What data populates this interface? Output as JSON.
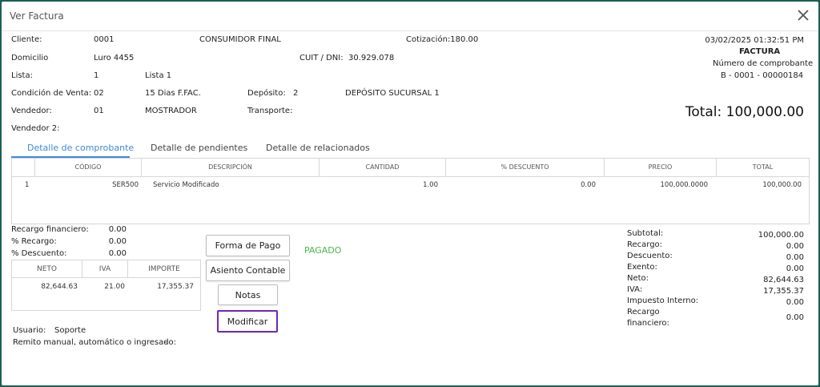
{
  "window": {
    "title": "Ver Factura",
    "close_icon": "close-icon"
  },
  "header": {
    "cliente_label": "Cliente:",
    "cliente_code": "0001",
    "cliente_name": "CONSUMIDOR FINAL",
    "cotizacion": "Cotización:180.00",
    "domicilio_label": "Domicilio",
    "domicilio_value": "Luro 4455",
    "cuit_label": "CUIT / DNI:",
    "cuit_value": "30.929.078",
    "lista_label": "Lista:",
    "lista_code": "1",
    "lista_name": "Lista 1",
    "condicion_label": "Condición de Venta:",
    "condicion_code": "02",
    "condicion_name": "15 Dias F.FAC.",
    "deposito_label": "Depósito:",
    "deposito_code": "2",
    "deposito_name": "DEPÓSITO SUCURSAL 1",
    "vendedor_label": "Vendedor:",
    "vendedor_code": "01",
    "vendedor_name": "MOSTRADOR",
    "transporte_label": "Transporte:",
    "vendedor2_label": "Vendedor 2:",
    "datetime": "03/02/2025 01:32:51 PM",
    "doc_type": "FACTURA",
    "comprobante_label": "Número de comprobante",
    "comprobante_number": "B - 0001 - 00000184",
    "total": "Total:  100,000.00"
  },
  "tabs": [
    "Detalle de comprobante",
    "Detalle de pendientes",
    "Detalle de relacionados"
  ],
  "detail": {
    "headers": [
      "CÓDIGO",
      "DESCRIPCIÓN",
      "CANTIDAD",
      "% DESCUENTO",
      "PRECIO",
      "TOTAL"
    ],
    "rows": [
      {
        "n": "1",
        "codigo": "SER500",
        "descripcion": "Servicio Modificado",
        "cantidad": "1.00",
        "descuento": "0.00",
        "precio": "100,000.0000",
        "total": "100,000.00"
      }
    ]
  },
  "left_summary": {
    "recargo_financiero_label": "Recargo financiero:",
    "recargo_financiero": "0.00",
    "recargo_pct_label": "% Recargo:",
    "recargo_pct": "0.00",
    "descuento_pct_label": "% Descuento:",
    "descuento_pct": "0.00"
  },
  "iva_table": {
    "headers": [
      "NETO",
      "IVA",
      "IMPORTE"
    ],
    "rows": [
      {
        "neto": "82,644.63",
        "iva": "21.00",
        "importe": "17,355.37"
      }
    ]
  },
  "usuario": {
    "label": "Usuario:",
    "value": "Soporte"
  },
  "remito": {
    "label": "Remito manual, automático o ingresado:",
    "value": "-"
  },
  "buttons": {
    "forma_pago": "Forma de Pago",
    "asiento": "Asiento Contable",
    "notas": "Notas",
    "modificar": "Modificar"
  },
  "status": {
    "text": "PAGADO",
    "color": "#4ab84a"
  },
  "totals": {
    "subtotal_label": "Subtotal:",
    "subtotal": "100,000.00",
    "recargo_label": "Recargo:",
    "recargo": "0.00",
    "descuento_label": "Descuento:",
    "descuento": "0.00",
    "exento_label": "Exento:",
    "exento": "0.00",
    "neto_label": "Neto:",
    "neto": "82,644.63",
    "iva_label": "IVA:",
    "iva": "17,355.37",
    "impuesto_label": "Impuesto Interno:",
    "impuesto": "0.00",
    "recargo_fin_label_1": "Recargo",
    "recargo_fin_label_2": "financiero:",
    "recargo_fin": "0.00"
  },
  "colors": {
    "accent": "#3f8ad6",
    "focus_border": "#6a2ab5",
    "backdrop": "#1f5e52"
  }
}
